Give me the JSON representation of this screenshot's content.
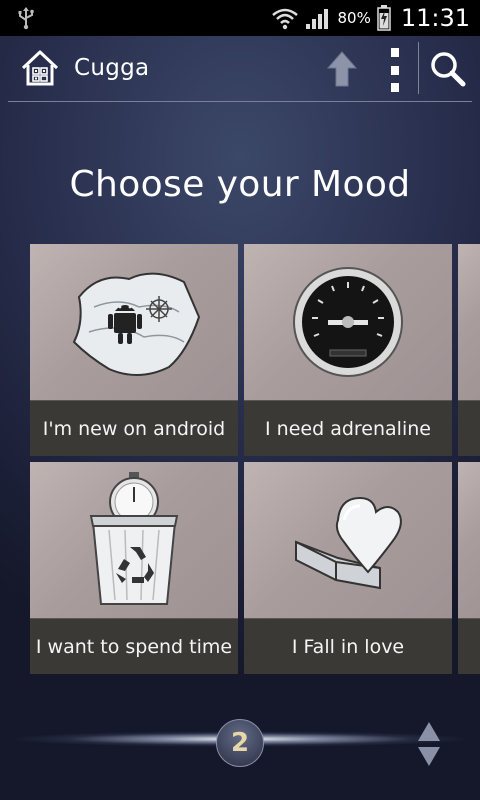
{
  "status_bar": {
    "battery_percent": "80%",
    "time": "11:31"
  },
  "action_bar": {
    "title": "Cugga"
  },
  "heading": "Choose your Mood",
  "moods": [
    {
      "label": "I'm new on android",
      "icon": "android-map-icon"
    },
    {
      "label": "I need adrenaline",
      "icon": "speedometer-icon"
    },
    {
      "label": "I want to spend time",
      "icon": "recycle-bin-stopwatch-icon"
    },
    {
      "label": "I Fall in love",
      "icon": "heart-box-icon"
    }
  ],
  "pager": {
    "current_page": "2"
  },
  "colors": {
    "background": "#232843",
    "tile_bg": "#a89c9c",
    "caption_bg": "#3a3936",
    "page_number": "#e7d6a8"
  }
}
